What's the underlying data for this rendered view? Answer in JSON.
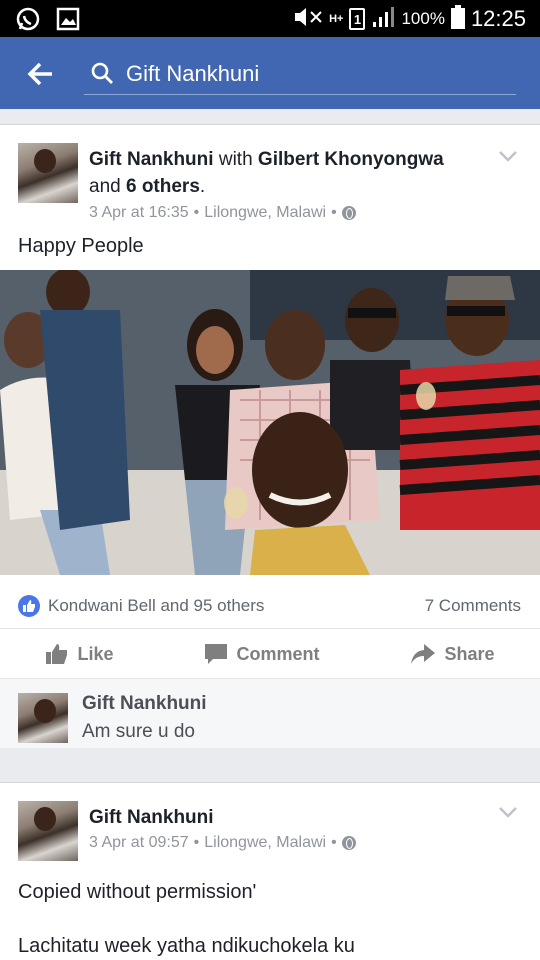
{
  "status_bar": {
    "battery": "100%",
    "time": "12:25",
    "network": "H+",
    "sim_slot": "1"
  },
  "search": {
    "query": "Gift Nankhuni"
  },
  "post1": {
    "author": "Gift Nankhuni",
    "with_word": "with",
    "tagged": "Gilbert Khonyongwa",
    "and_word": "and",
    "others": "6 others",
    "time": "3 Apr at 16:35",
    "location": "Lilongwe, Malawi",
    "text": "Happy People",
    "reactions_text": "Kondwani Bell and 95 others",
    "comments_count": "7 Comments",
    "actions": {
      "like": "Like",
      "comment": "Comment",
      "share": "Share"
    },
    "top_comment": {
      "author": "Gift Nankhuni",
      "text": "Am sure u do"
    }
  },
  "post2": {
    "author": "Gift Nankhuni",
    "time": "3 Apr at 09:57",
    "location": "Lilongwe, Malawi",
    "text_line1": "Copied without permission'",
    "text_line2": "Lachitatu week yatha ndikuchokela ku"
  },
  "colors": {
    "facebook_blue": "#4267b2",
    "like_blue": "#4a76e8",
    "meta_gray": "#90949c"
  }
}
